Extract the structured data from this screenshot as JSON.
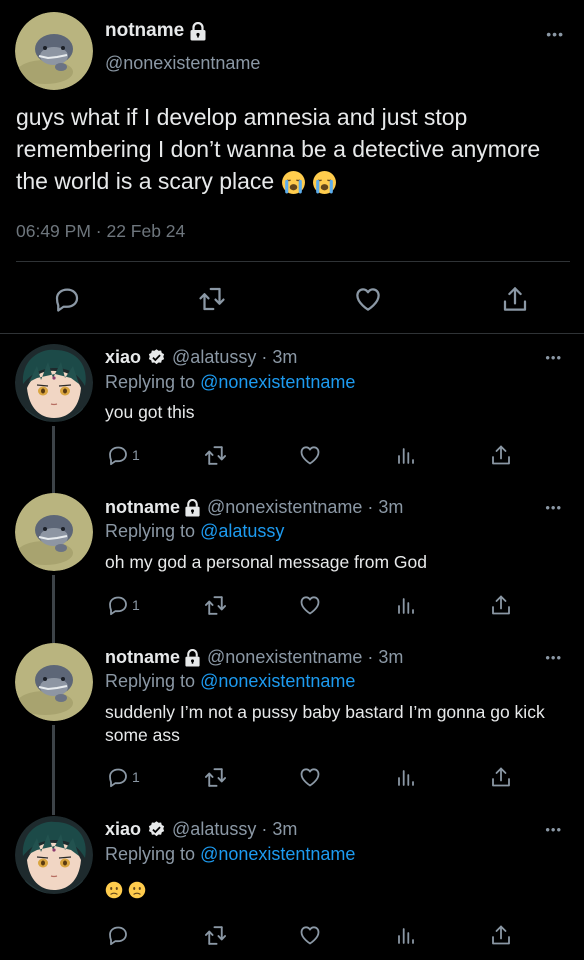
{
  "main_tweet": {
    "name": "notname",
    "handle": "@nonexistentname",
    "text": "guys what if I develop amnesia and just stop remembering I don’t wanna be a detective anymore the world is a scary place",
    "emojis": [
      "crying-face",
      "crying-face"
    ],
    "timestamp": "06:49 PM · 22 Feb 24",
    "more": "•••",
    "actions": [
      "reply-icon",
      "retweet-icon",
      "like-icon",
      "share-icon"
    ]
  },
  "replies": [
    {
      "name": "xiao",
      "verified": true,
      "meta": "@alatussy · 3m",
      "replying_prefix": "Replying to ",
      "replying_to": "@nonexistentname",
      "text": "you got this",
      "reply_count": "1",
      "more": "•••"
    },
    {
      "name": "notname",
      "locked": true,
      "meta": "@nonexistentname · 3m",
      "replying_prefix": "Replying to ",
      "replying_to": "@alatussy",
      "text": "oh my god a personal message from God",
      "reply_count": "1",
      "more": "•••"
    },
    {
      "name": "notname",
      "locked": true,
      "meta": "@nonexistentname · 3m",
      "replying_prefix": "Replying to ",
      "replying_to": "@nonexistentname",
      "text": "suddenly I’m not a pussy baby bastard I’m gonna go kick some ass",
      "reply_count": "1",
      "more": "•••"
    },
    {
      "name": "xiao",
      "verified": true,
      "meta": "@alatussy · 3m",
      "replying_prefix": "Replying to ",
      "replying_to": "@nonexistentname",
      "text": "",
      "emojis": [
        "slightly-frowning-face",
        "slightly-frowning-face"
      ],
      "reply_count": "",
      "more": "•••"
    }
  ],
  "colors": {
    "background": "#000000",
    "text_primary": "#e7e9ea",
    "text_secondary": "#8b98a5",
    "link": "#1d9bf0",
    "divider": "#2f3336"
  }
}
